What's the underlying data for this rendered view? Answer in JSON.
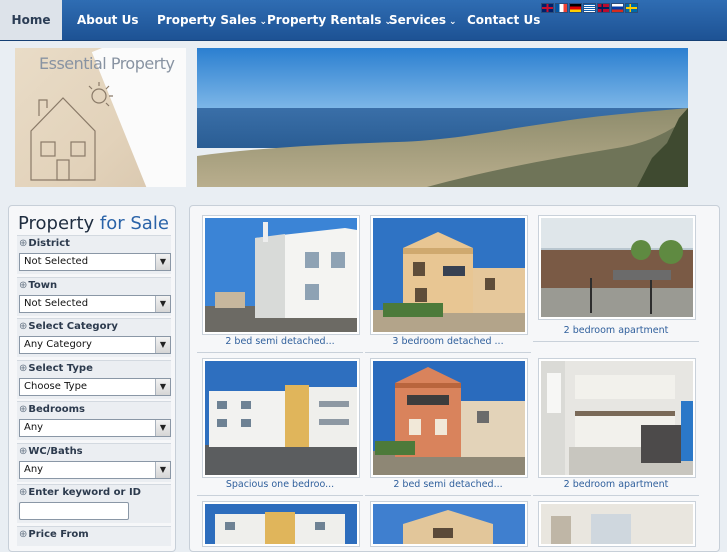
{
  "nav": {
    "items": [
      {
        "label": "Home",
        "active": true,
        "dropdown": false
      },
      {
        "label": "About Us",
        "active": false,
        "dropdown": false
      },
      {
        "label": "Property Sales",
        "active": false,
        "dropdown": true
      },
      {
        "label": "Property Rentals",
        "active": false,
        "dropdown": true
      },
      {
        "label": "Services",
        "active": false,
        "dropdown": true
      },
      {
        "label": "Contact Us",
        "active": false,
        "dropdown": false
      }
    ],
    "caret": "⌄",
    "flags": [
      "uk-flag-icon",
      "france-flag-icon",
      "germany-flag-icon",
      "greece-flag-icon",
      "norway-flag-icon",
      "russia-flag-icon",
      "sweden-flag-icon"
    ]
  },
  "header": {
    "logo_text": "Essential Property"
  },
  "sidebar": {
    "title_main": "Property",
    "title_rest": " for Sale",
    "filters": [
      {
        "label": "District",
        "value": "Not Selected",
        "kind": "select"
      },
      {
        "label": "Town",
        "value": "Not Selected",
        "kind": "select"
      },
      {
        "label": "Select Category",
        "value": "Any Category",
        "kind": "select"
      },
      {
        "label": "Select Type",
        "value": "Choose Type",
        "kind": "select"
      },
      {
        "label": "Bedrooms",
        "value": "Any",
        "kind": "select"
      },
      {
        "label": "WC/Baths",
        "value": "Any",
        "kind": "select"
      },
      {
        "label": "Enter keyword or ID",
        "value": "",
        "kind": "text"
      },
      {
        "label": "Price From",
        "value": "",
        "kind": "select"
      }
    ]
  },
  "gallery": {
    "cards": [
      {
        "caption": "2 bed semi detached..."
      },
      {
        "caption": "3 bedroom detached ..."
      },
      {
        "caption": "2 bedroom apartment"
      },
      {
        "caption": "Spacious one bedroo..."
      },
      {
        "caption": "2 bed semi detached..."
      },
      {
        "caption": "2 bedroom apartment"
      },
      {
        "caption": ""
      },
      {
        "caption": ""
      },
      {
        "caption": ""
      }
    ]
  },
  "colors": {
    "nav_blue": "#1d5294",
    "link_blue": "#2f5f9c",
    "title_blue": "#2a63a8"
  }
}
